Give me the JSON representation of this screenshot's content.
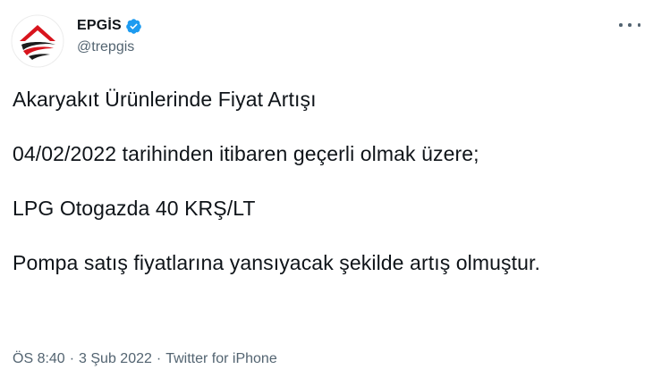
{
  "author": {
    "display_name": "EPGİS",
    "handle": "@trepgis",
    "verified_icon": "verified-badge-icon",
    "avatar_icon": "epgis-logo-icon",
    "avatar_colors": {
      "red": "#d8141d",
      "black": "#1c1c1c"
    }
  },
  "menu": {
    "icon": "more-options-icon"
  },
  "tweet": {
    "lines": [
      "Akaryakıt Ürünlerinde Fiyat Artışı",
      "04/02/2022 tarihinden itibaren geçerli olmak üzere;",
      "LPG Otogazda 40 KRŞ/LT",
      "Pompa satış fiyatlarına yansıyacak şekilde artış olmuştur."
    ]
  },
  "meta": {
    "time": "ÖS 8:40",
    "date": "3 Şub 2022",
    "separator": "·",
    "source": "Twitter for iPhone"
  },
  "colors": {
    "text": "#0f1419",
    "secondary": "#536471",
    "verified": "#1d9bf0"
  }
}
